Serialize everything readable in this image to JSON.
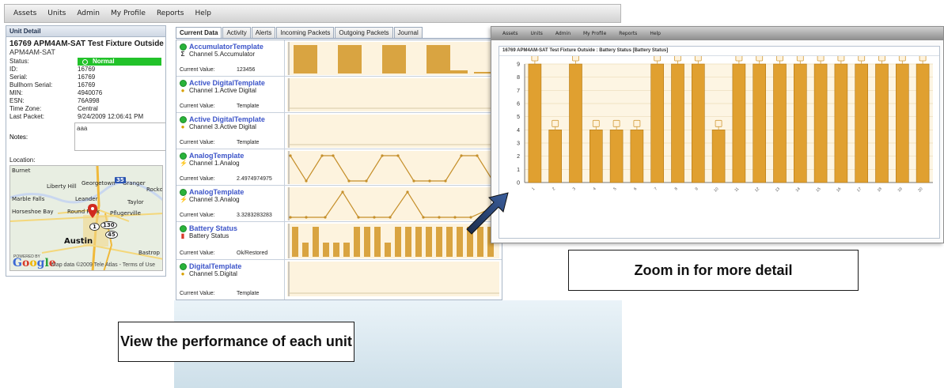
{
  "menu": {
    "items": [
      "Assets",
      "Units",
      "Admin",
      "My Profile",
      "Reports",
      "Help"
    ]
  },
  "unit_detail": {
    "header": "Unit Detail",
    "title": "16769 APM4AM-SAT Test Fixture Outside",
    "subtitle": "APM4AM-SAT",
    "status_label": "Status:",
    "status_value": "Normal",
    "properties": [
      {
        "key": "ID:",
        "value": "16769"
      },
      {
        "key": "Serial:",
        "value": "16769"
      },
      {
        "key": "Bullhorn Serial:",
        "value": "16769"
      },
      {
        "key": "MIN:",
        "value": "4940076"
      },
      {
        "key": "ESN:",
        "value": "76A998"
      },
      {
        "key": "Time Zone:",
        "value": "Central"
      },
      {
        "key": "Last Packet:",
        "value": "9/24/2009 12:06:41 PM"
      }
    ],
    "notes_label": "Notes:",
    "notes_value": "aaa",
    "location_label": "Location:",
    "map": {
      "towns": [
        "Georgetown",
        "Liberty Hill",
        "Marble Falls",
        "Leander",
        "Taylor",
        "Round Rock",
        "Pflugerville",
        "Austin",
        "Bastrop",
        "Granger",
        "Rockdale",
        "Horseshoe Bay",
        "Burnet"
      ],
      "highways": [
        "35",
        "130",
        "45",
        "1"
      ],
      "powered_by": "POWERED BY",
      "logo": "Google",
      "copyright": "Map data ©2009 Tele Atlas - Terms of Use"
    }
  },
  "tabs": [
    "Current Data",
    "Activity",
    "Alerts",
    "Incoming Packets",
    "Outgoing Packets",
    "Journal"
  ],
  "current_value_label": "Current Value:",
  "channels": [
    {
      "name": "AccumulatorTemplate",
      "sub": "Channel 5.Accumulator",
      "icon": "sigma-icon",
      "value": "123456"
    },
    {
      "name": "Active DigitalTemplate",
      "sub": "Channel 1.Active Digital",
      "icon": "digital-icon",
      "value": "Template"
    },
    {
      "name": "Active DigitalTemplate",
      "sub": "Channel 3.Active Digital",
      "icon": "digital-icon",
      "value": "Template"
    },
    {
      "name": "AnalogTemplate",
      "sub": "Channel 1.Analog",
      "icon": "analog-icon",
      "value": "2.4974974975"
    },
    {
      "name": "AnalogTemplate",
      "sub": "Channel 3.Analog",
      "icon": "analog-icon",
      "value": "3.3283283283"
    },
    {
      "name": "Battery Status",
      "sub": "Battery Status",
      "icon": "battery-icon",
      "value": "Ok/Restored"
    },
    {
      "name": "DigitalTemplate",
      "sub": "Channel 5.Digital",
      "icon": "digital-icon",
      "value": "Template"
    }
  ],
  "zoom": {
    "menu": [
      "Assets",
      "Units",
      "Admin",
      "My Profile",
      "Reports",
      "Help"
    ],
    "title": "16769 APM4AM-SAT Test Fixture Outside : Battery Status [Battery Status]"
  },
  "chart_data": {
    "type": "bar",
    "title": "16769 APM4AM-SAT Test Fixture Outside : Battery Status [Battery Status]",
    "xlabel": "",
    "ylabel": "",
    "ylim": [
      0,
      9
    ],
    "yticks": [
      0,
      1,
      2,
      3,
      4,
      5,
      6,
      7,
      8,
      9
    ],
    "grid": true,
    "legend": "none",
    "bar_color": "#e0a030",
    "categories": [
      "1",
      "2",
      "3",
      "4",
      "5",
      "6",
      "7",
      "8",
      "9",
      "10",
      "11",
      "12",
      "13",
      "14",
      "15",
      "16",
      "17",
      "18",
      "19",
      "20"
    ],
    "values": [
      9,
      4,
      9,
      4,
      4,
      4,
      9,
      9,
      9,
      4,
      9,
      9,
      9,
      9,
      9,
      9,
      9,
      9,
      9,
      9
    ]
  },
  "callouts": {
    "zoom": "Zoom in for more detail",
    "view": "View the performance of each unit"
  },
  "colors": {
    "accent_blue": "#3d55c9",
    "status_green": "#22c22a",
    "bar_orange": "#e0a030"
  }
}
